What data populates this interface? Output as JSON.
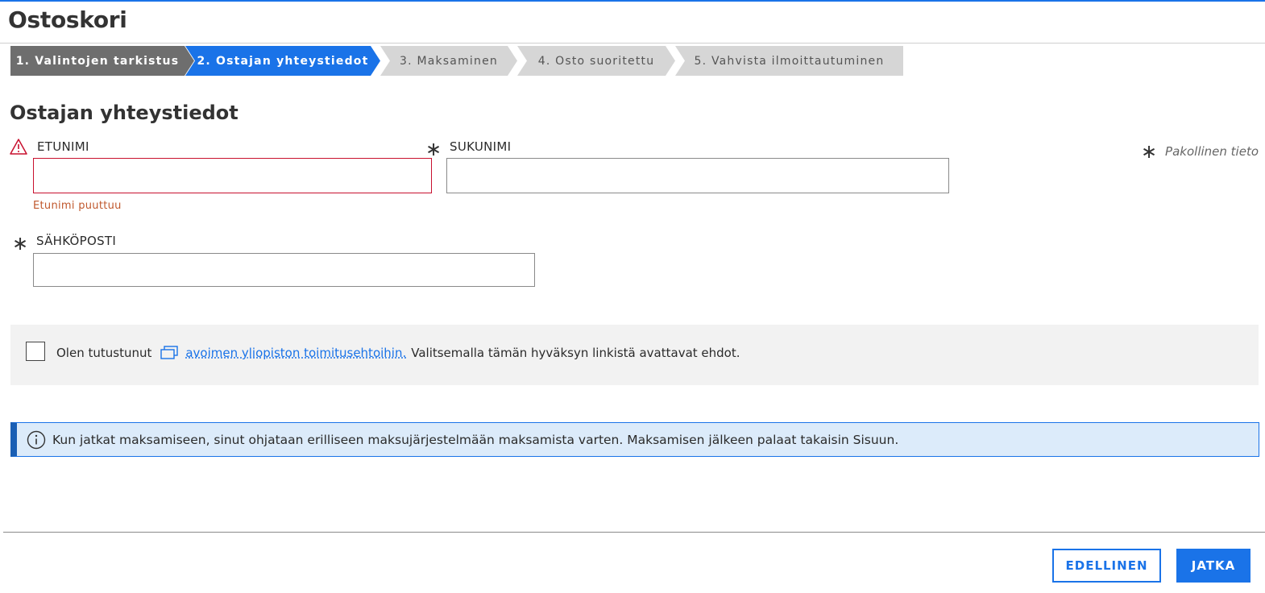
{
  "page": {
    "title": "Ostoskori"
  },
  "stepper": {
    "steps": [
      {
        "label": "1. Valintojen tarkistus",
        "state": "done"
      },
      {
        "label": "2. Ostajan yhteystiedot",
        "state": "active"
      },
      {
        "label": "3. Maksaminen",
        "state": "pending"
      },
      {
        "label": "4. Osto suoritettu",
        "state": "pending"
      },
      {
        "label": "5. Vahvista ilmoittautuminen",
        "state": "pending"
      }
    ]
  },
  "form": {
    "section_title": "Ostajan yhteystiedot",
    "required_symbol": "∗",
    "required_note": "Pakollinen tieto",
    "first_name": {
      "label": "ETUNIMI",
      "value": "",
      "error": "Etunimi puuttuu"
    },
    "last_name": {
      "label": "SUKUNIMI",
      "value": ""
    },
    "email": {
      "label": "SÄHKÖPOSTI",
      "value": ""
    }
  },
  "terms": {
    "checked": false,
    "prefix": "Olen tutustunut",
    "link": "avoimen yliopiston toimitusehtoihin.",
    "suffix": "Valitsemalla tämän hyväksyn linkistä avattavat ehdot."
  },
  "notice": {
    "text": "Kun jatkat maksamiseen, sinut ohjataan erilliseen maksujärjestelmään maksamista varten. Maksamisen jälkeen palaat takaisin Sisuun."
  },
  "buttons": {
    "previous": "EDELLINEN",
    "continue": "JATKA"
  },
  "colors": {
    "accent": "#1a73e8",
    "error": "#c8102e",
    "done_step": "#6e6e6e",
    "pending_step": "#d6d6d6",
    "notice_bg": "#dcebfa"
  },
  "icons": {
    "warning": "warning-icon",
    "info": "info-icon",
    "external_link": "external-link-icon"
  }
}
